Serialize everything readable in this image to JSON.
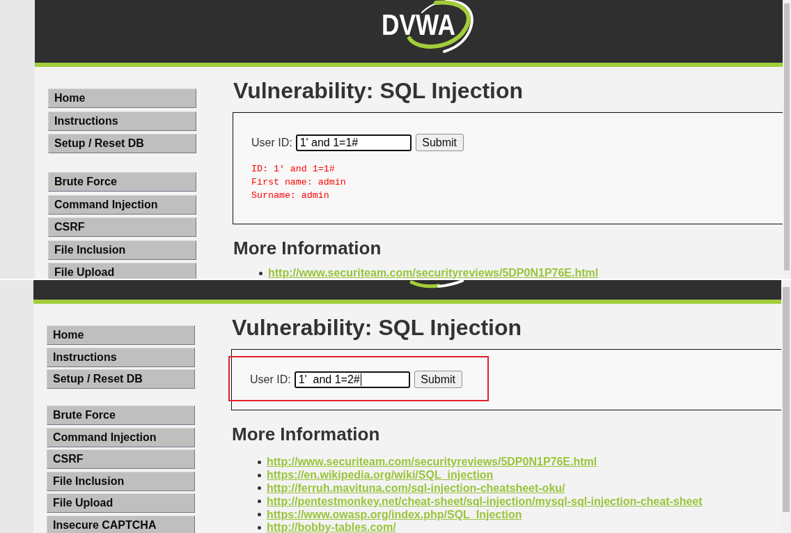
{
  "screenshots": [
    {
      "kind": "full",
      "logo": "DVWA",
      "menu_groups": [
        {
          "items": [
            {
              "label": "Home",
              "selected": false
            },
            {
              "label": "Instructions",
              "selected": false
            },
            {
              "label": "Setup / Reset DB",
              "selected": false
            }
          ]
        },
        {
          "items": [
            {
              "label": "Brute Force",
              "selected": false
            },
            {
              "label": "Command Injection",
              "selected": false
            },
            {
              "label": "CSRF",
              "selected": false
            },
            {
              "label": "File Inclusion",
              "selected": false
            },
            {
              "label": "File Upload",
              "selected": false
            }
          ]
        }
      ],
      "title": "Vulnerability: SQL Injection",
      "form": {
        "label": "User ID:",
        "value": "1' and 1=1#",
        "caret": false,
        "button": "Submit",
        "highlighted": false,
        "output": [
          "ID: 1' and 1=1#",
          "First name: admin",
          "Surname: admin"
        ]
      },
      "more_info": {
        "heading": "More Information",
        "links": [
          "http://www.securiteam.com/securityreviews/5DP0N1P76E.html"
        ]
      }
    },
    {
      "kind": "scrolled",
      "menu_groups": [
        {
          "items": [
            {
              "label": "Home",
              "selected": false
            },
            {
              "label": "Instructions",
              "selected": false
            },
            {
              "label": "Setup / Reset DB",
              "selected": false
            }
          ]
        },
        {
          "items": [
            {
              "label": "Brute Force",
              "selected": false
            },
            {
              "label": "Command Injection",
              "selected": false
            },
            {
              "label": "CSRF",
              "selected": false
            },
            {
              "label": "File Inclusion",
              "selected": false
            },
            {
              "label": "File Upload",
              "selected": false
            },
            {
              "label": "Insecure CAPTCHA",
              "selected": false
            }
          ]
        }
      ],
      "title": "Vulnerability: SQL Injection",
      "form": {
        "label": "User ID:",
        "value": "1'  and 1=2#",
        "caret": true,
        "button": "Submit",
        "highlighted": true
      },
      "more_info": {
        "heading": "More Information",
        "links": [
          "http://www.securiteam.com/securityreviews/5DP0N1P76E.html",
          "https://en.wikipedia.org/wiki/SQL_injection",
          "http://ferruh.mavituna.com/sql-injection-cheatsheet-oku/",
          "http://pentestmonkey.net/cheat-sheet/sql-injection/mysql-sql-injection-cheat-sheet",
          "https://www.owasp.org/index.php/SQL_Injection",
          "http://bobby-tables.com/"
        ]
      }
    }
  ]
}
